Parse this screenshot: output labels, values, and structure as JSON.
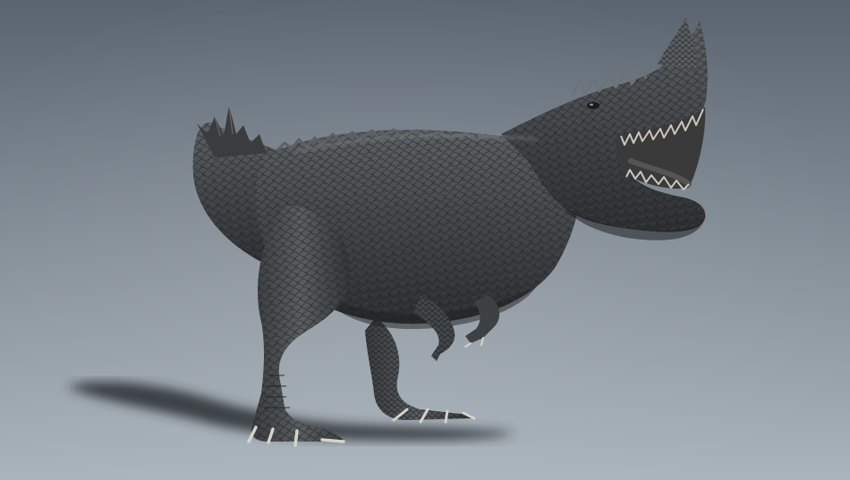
{
  "scene": {
    "subject": "dinosaur-sculpt",
    "colors": {
      "background_top": "#5b6570",
      "background_bottom": "#aab4bc",
      "skin_dark": "#2f3133",
      "skin_mid": "#4a4d50",
      "skin_light": "#6e7275",
      "shadow": "#2b2e31",
      "mouth_inner": "#3a3a3a",
      "teeth": "#c9c6bd"
    }
  }
}
